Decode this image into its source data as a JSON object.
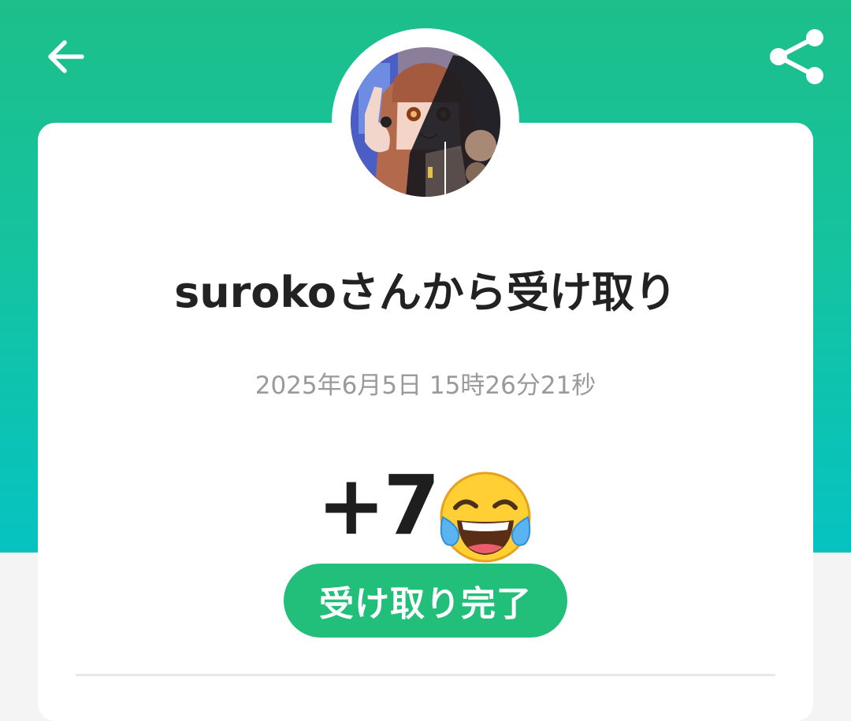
{
  "header": {
    "back_icon": "arrow-left-icon",
    "share_icon": "share-icon",
    "background_colors": [
      "#1dbf8a",
      "#06c3c2"
    ]
  },
  "receipt": {
    "sender_avatar": "avatar",
    "title": "surokoさんから受け取り",
    "timestamp": "2025年6月5日 15時26分21秒",
    "amount": "+7",
    "emoji": "face-with-tears-of-joy-icon",
    "status_label": "受け取り完了",
    "status_color": "#22bf7a"
  }
}
